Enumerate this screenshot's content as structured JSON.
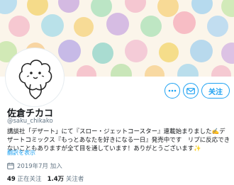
{
  "profile": {
    "name": "佐倉チカコ",
    "handle": "@saku_chikako",
    "bio_line": "講談社「デザート」にて『スロー・ジェットコースター』連載始まりました✍️デザートコミックス『もっとあなたを好きになる一日』発売中です　リプに反応できないこともありますが全て目を通しています！ありがとうございます",
    "bio_emoji": "✨",
    "translate_link": "翻訳を表示",
    "joined": "2019年7月 加入",
    "following_count": "49",
    "following_label": "正在关注",
    "followers_count": "1.4万",
    "followers_label": "关注者"
  },
  "actions": {
    "more_icon": "more-horizontal-icon",
    "message_icon": "envelope-icon",
    "follow_label": "关注"
  },
  "colors": {
    "accent": "#1da1f2",
    "banner_bg": "#fbf5ea"
  }
}
